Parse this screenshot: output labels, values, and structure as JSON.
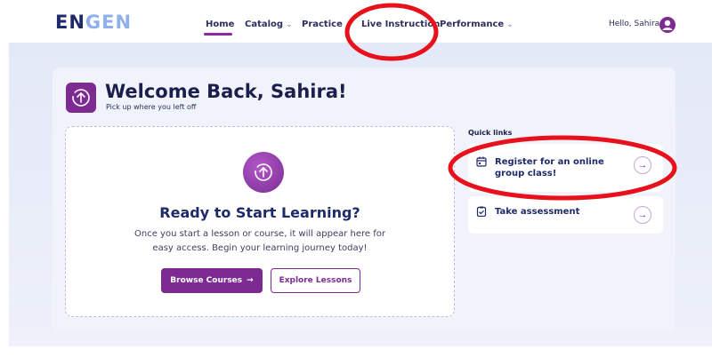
{
  "nav": {
    "logo_part1": "EN",
    "logo_part2": "GEN",
    "items": [
      {
        "label": "Home"
      },
      {
        "label": "Catalog",
        "chevron": "⌄"
      },
      {
        "label": "Practice",
        "chevron": "⌄"
      },
      {
        "label": "Live Instruction"
      },
      {
        "label": "Performance",
        "chevron": "⌄"
      }
    ],
    "greeting": "Hello, Sahira",
    "user_icon": "user-icon"
  },
  "welcome": {
    "title": "Welcome Back, Sahira!",
    "subtitle": "Pick up where you left off"
  },
  "main_card": {
    "heading": "Ready to Start Learning?",
    "body": "Once you start a lesson or course, it will appear here for easy access. Begin your learning journey today!",
    "primary_button": "Browse Courses",
    "primary_arrow": "→",
    "secondary_button": "Explore Lessons"
  },
  "quick_links": {
    "title": "Quick links",
    "items": [
      {
        "label": "Register for an online group class!",
        "icon": "calendar-icon",
        "arrow": "→"
      },
      {
        "label": "Take assessment",
        "icon": "clipboard-check-icon",
        "arrow": "→"
      }
    ]
  },
  "colors": {
    "brand_purple": "#7d2a93",
    "navy": "#1f2a6b",
    "annotation_red": "#e8101a"
  }
}
